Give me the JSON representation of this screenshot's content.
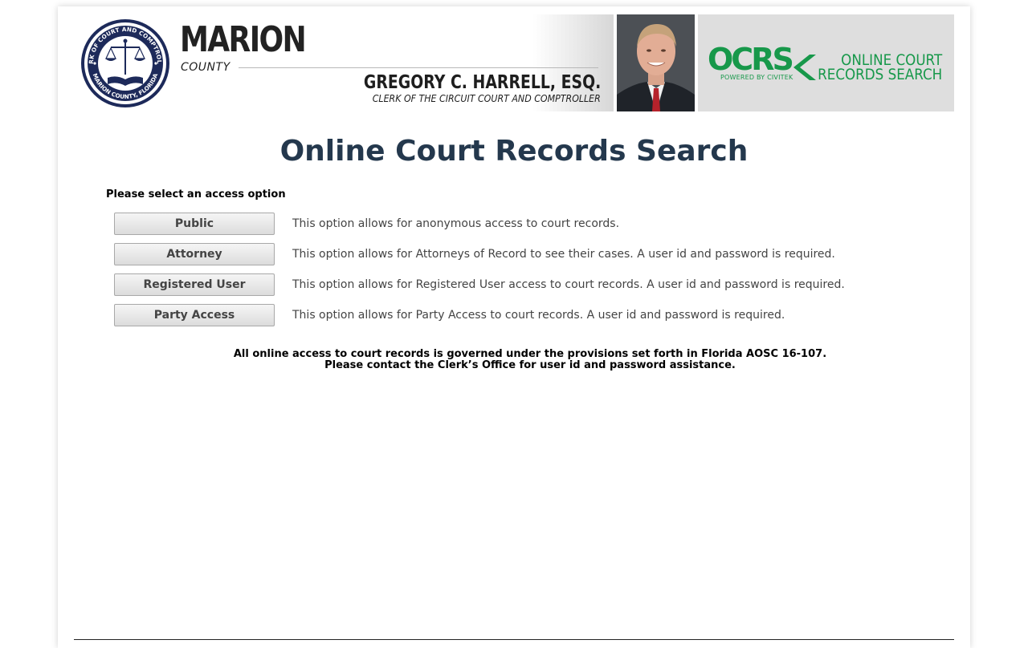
{
  "header": {
    "county_name": "MARION",
    "county_sub": "COUNTY",
    "seal_top_text": "CLERK OF COURT AND COMPTROLLER",
    "seal_bottom_text": "MARION COUNTY, FLORIDA",
    "clerk_name": "GREGORY C. HARRELL, ESQ.",
    "clerk_title": "CLERK OF THE CIRCUIT COURT AND COMPTROLLER",
    "ocrs_mark": "OCRS",
    "ocrs_powered": "POWERED BY CIVITEK",
    "ocrs_line1": "ONLINE COURT",
    "ocrs_line2": "RECORDS SEARCH"
  },
  "main": {
    "title": "Online Court Records Search",
    "prompt": "Please select an access option",
    "options": [
      {
        "label": "Public",
        "description": "This option allows for anonymous access to court records."
      },
      {
        "label": "Attorney",
        "description": "This option allows for Attorneys of Record to see their cases. A user id and password is required."
      },
      {
        "label": "Registered User",
        "description": "This option allows for Registered User access to court records. A user id and password is required."
      },
      {
        "label": "Party Access",
        "description": "This option allows for Party Access to court records. A user id and password is required."
      }
    ],
    "notice_line1": "All online access to court records is governed under the provisions set forth in Florida AOSC 16-107.",
    "notice_line2": "Please contact the Clerk’s Office for user id and password assistance."
  },
  "colors": {
    "title": "#24384d",
    "ocrs_green": "#17984a",
    "seal_navy": "#1d2a5a"
  }
}
